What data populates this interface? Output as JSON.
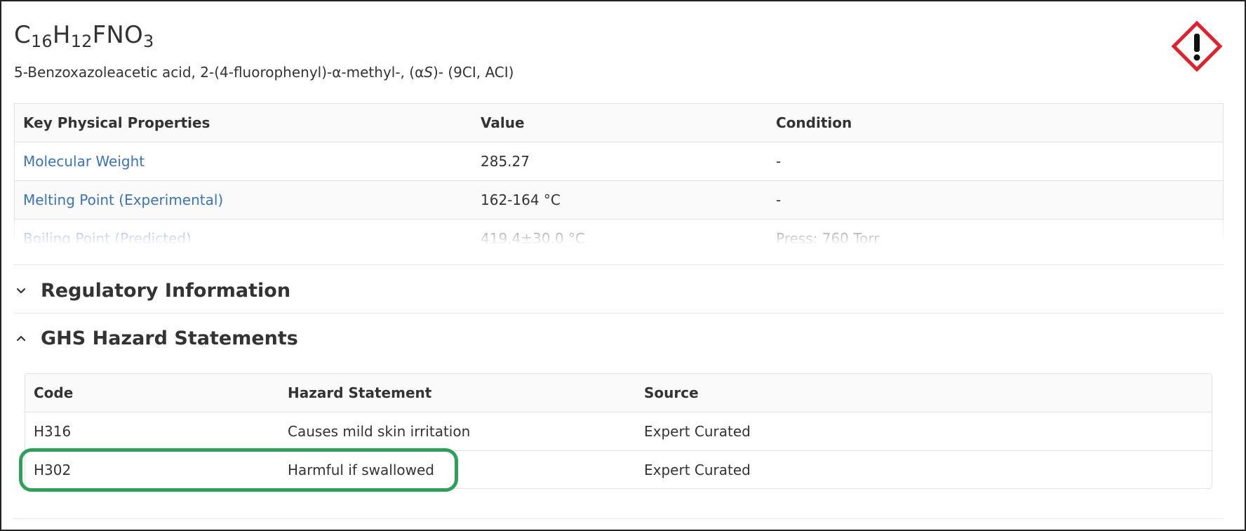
{
  "compound": {
    "formula": [
      {
        "t": "C",
        "sub": false
      },
      {
        "t": "16",
        "sub": true
      },
      {
        "t": "H",
        "sub": false
      },
      {
        "t": "12",
        "sub": true
      },
      {
        "t": "FNO",
        "sub": false
      },
      {
        "t": "3",
        "sub": true
      }
    ],
    "name_parts": [
      {
        "t": "5-Benzoxazoleacetic acid, 2-(4-fluorophenyl)-α-methyl-, (α",
        "italic": false
      },
      {
        "t": "S",
        "italic": true
      },
      {
        "t": ")- (9CI, ACI)",
        "italic": false
      }
    ]
  },
  "ghs_pictogram": {
    "icon": "exclamation-mark-diamond-icon",
    "border_color": "#e3202d"
  },
  "key_properties": {
    "headers": [
      "Key Physical Properties",
      "Value",
      "Condition"
    ],
    "rows": [
      {
        "property": "Molecular Weight",
        "value": "285.27",
        "condition": "-"
      },
      {
        "property": "Melting Point (Experimental)",
        "value": "162-164 °C",
        "condition": "-"
      },
      {
        "property": "Boiling Point (Predicted)",
        "value": "419.4±30.0 °C",
        "condition": "Press: 760 Torr"
      }
    ]
  },
  "sections": {
    "regulatory": {
      "title": "Regulatory Information",
      "expanded": false,
      "icon": "chevron-down-icon"
    },
    "ghs": {
      "title": "GHS Hazard Statements",
      "expanded": true,
      "icon": "chevron-up-icon"
    }
  },
  "ghs_table": {
    "headers": [
      "Code",
      "Hazard Statement",
      "Source"
    ],
    "rows": [
      {
        "code": "H316",
        "statement": "Causes mild skin irritation",
        "source": "Expert Curated"
      },
      {
        "code": "H302",
        "statement": "Harmful if swallowed",
        "source": "Expert Curated"
      }
    ]
  },
  "colors": {
    "link": "#3b73b9",
    "highlight": "#2ea05a",
    "text": "#333333"
  }
}
